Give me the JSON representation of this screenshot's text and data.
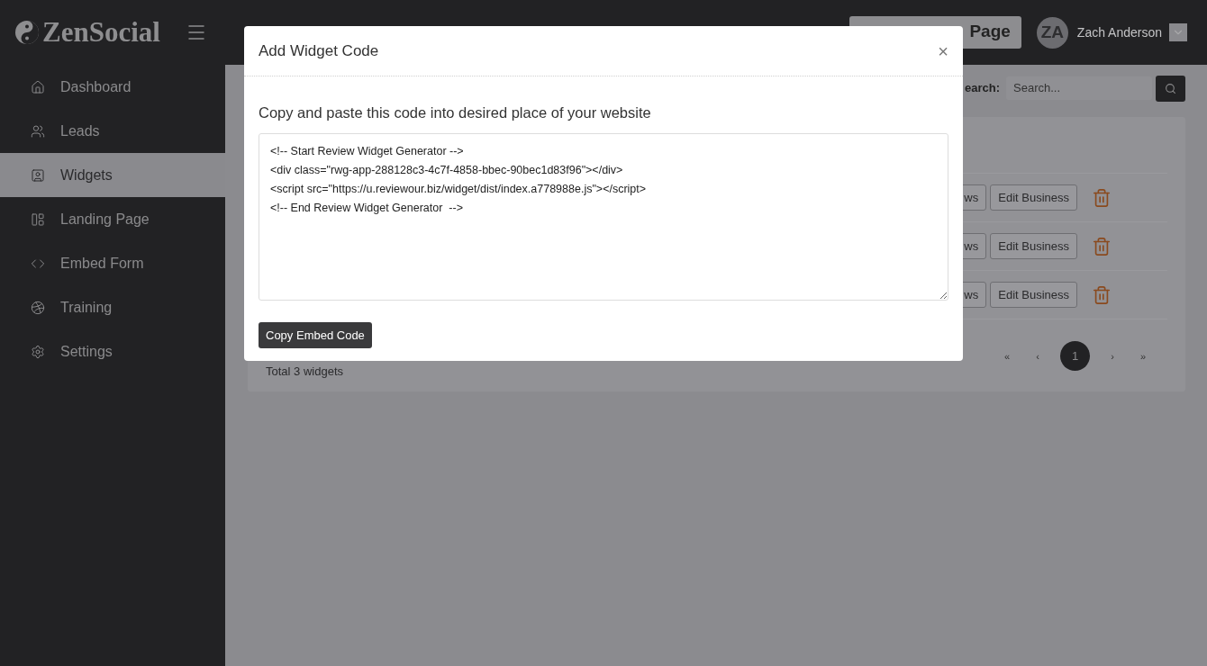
{
  "app": {
    "logo": "ZenSocial"
  },
  "sidebar": {
    "items": [
      {
        "label": "Dashboard",
        "selected": false
      },
      {
        "label": "Leads",
        "selected": false
      },
      {
        "label": "Widgets",
        "selected": true
      },
      {
        "label": "Landing Page",
        "selected": false
      },
      {
        "label": "Embed Form",
        "selected": false
      },
      {
        "label": "Training",
        "selected": false
      },
      {
        "label": "Settings",
        "selected": false
      }
    ]
  },
  "header": {
    "button": "Page",
    "user": {
      "initials": "ZA",
      "name": "Zach Anderson"
    }
  },
  "toolbar": {
    "search_label": "earch:",
    "search_placeholder": "Search..."
  },
  "table": {
    "rows": [
      {
        "actions": [
          "ws",
          "Edit Business"
        ]
      },
      {
        "actions": [
          "ws",
          "Edit Business"
        ]
      },
      {
        "actions": [
          "ws",
          "Edit Business"
        ]
      }
    ],
    "footer": "Total 3 widgets",
    "pagination": [
      {
        "label": "«",
        "selected": false
      },
      {
        "label": "‹",
        "selected": false
      },
      {
        "label": "1",
        "selected": true
      },
      {
        "label": "›",
        "selected": false
      },
      {
        "label": "»",
        "selected": false
      }
    ]
  },
  "modal": {
    "title": "Add Widget Code",
    "close": "×",
    "instruction": "Copy and paste this code into desired place of your website",
    "code": [
      "<!-- Start Review Widget Generator -->",
      "<div class=\"rwg-app-288128c3-4c7f-4858-bbec-90bec1d83f96\"></div>",
      "<script src=\"https://u.reviewour.biz/widget/dist/index.a778988e.js\"></script>",
      "<!-- End Review Widget Generator  -->"
    ],
    "button": "Copy Embed Code"
  }
}
